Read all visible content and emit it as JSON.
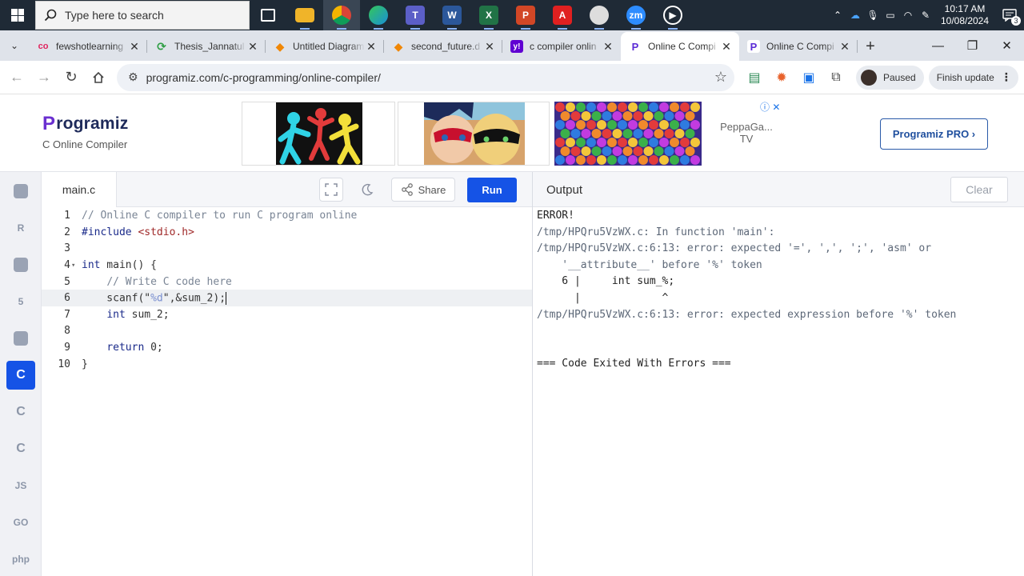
{
  "taskbar": {
    "search_placeholder": "Type here to search",
    "apps": [
      {
        "name": "task-view",
        "label": "",
        "color": "#1f2a36"
      },
      {
        "name": "file-explorer",
        "label": "",
        "color": "#f0b429"
      },
      {
        "name": "chrome",
        "label": "",
        "color": "#db4437"
      },
      {
        "name": "edge",
        "label": "",
        "color": "#2aa1d8"
      },
      {
        "name": "teams",
        "label": "T",
        "color": "#5b5fc7"
      },
      {
        "name": "word",
        "label": "W",
        "color": "#2b579a"
      },
      {
        "name": "excel",
        "label": "X",
        "color": "#217346"
      },
      {
        "name": "powerpoint",
        "label": "P",
        "color": "#d24726"
      },
      {
        "name": "acrobat",
        "label": "A",
        "color": "#e02020"
      },
      {
        "name": "paint",
        "label": "",
        "color": "#dddddd"
      },
      {
        "name": "zoom",
        "label": "zm",
        "color": "#2d8cff"
      },
      {
        "name": "media-player",
        "label": "▶",
        "color": "#333333"
      }
    ],
    "clock_time": "10:17 AM",
    "clock_date": "10/08/2024",
    "notification_count": "3"
  },
  "browser": {
    "tabs": [
      {
        "title": "fewshotlearning",
        "favicon_color": "#e0245e",
        "favicon_label": "co",
        "active": false
      },
      {
        "title": "Thesis_Jannatul",
        "favicon_color": "#2e9e44",
        "favicon_label": "⟳",
        "active": false
      },
      {
        "title": "Untitled Diagram",
        "favicon_color": "#f08705",
        "favicon_label": "◆",
        "active": false
      },
      {
        "title": "second_future.d",
        "favicon_color": "#f08705",
        "favicon_label": "◆",
        "active": false
      },
      {
        "title": "c compiler onlin",
        "favicon_color": "#6001d2",
        "favicon_label": "y!",
        "active": false
      },
      {
        "title": "Online C Compi",
        "favicon_color": "#ffffff",
        "favicon_label": "P",
        "active": true
      },
      {
        "title": "Online C Compi",
        "favicon_color": "#ffffff",
        "favicon_label": "P",
        "active": false
      }
    ],
    "url": "programiz.com/c-programming/online-compiler/",
    "profile_status": "Paused",
    "update_label": "Finish update"
  },
  "site": {
    "brand": "rogramiz",
    "brand_mark": "P",
    "subtitle": "C Online Compiler",
    "ad_label": "PeppaGa... TV",
    "pro_button": "Programiz PRO ›",
    "rail": [
      {
        "name": "python",
        "label": "",
        "active": false
      },
      {
        "name": "r",
        "label": "R",
        "active": false
      },
      {
        "name": "sql",
        "label": "",
        "active": false
      },
      {
        "name": "html",
        "label": "5",
        "active": false
      },
      {
        "name": "java",
        "label": "",
        "active": false
      },
      {
        "name": "c",
        "label": "C",
        "active": true
      },
      {
        "name": "cpp",
        "label": "C",
        "active": false
      },
      {
        "name": "csharp",
        "label": "C",
        "active": false
      },
      {
        "name": "js",
        "label": "JS",
        "active": false
      },
      {
        "name": "go",
        "label": "GO",
        "active": false
      },
      {
        "name": "php",
        "label": "php",
        "active": false
      }
    ]
  },
  "editor": {
    "filename": "main.c",
    "share_label": "Share",
    "run_label": "Run",
    "lines": [
      {
        "n": "1",
        "fold": "",
        "html": "<span class='c-com'>// Online C compiler to run C program online</span>"
      },
      {
        "n": "2",
        "fold": "",
        "html": "<span class='c-kw'>#include</span> <span class='c-inc'>&lt;stdio.h&gt;</span>"
      },
      {
        "n": "3",
        "fold": "",
        "html": ""
      },
      {
        "n": "4",
        "fold": "▾",
        "html": "<span class='c-kw'>int</span> main() {"
      },
      {
        "n": "5",
        "fold": "",
        "html": "    <span class='c-com'>// Write C code here</span>"
      },
      {
        "n": "6",
        "fold": "",
        "html": "    scanf(\"<span class='c-str'>%d</span>\",&amp;sum_2);<span class='caret'></span>",
        "current": true
      },
      {
        "n": "7",
        "fold": "",
        "html": "    <span class='c-kw'>int</span> sum_2;"
      },
      {
        "n": "8",
        "fold": "",
        "html": ""
      },
      {
        "n": "9",
        "fold": "",
        "html": "    <span class='c-kw'>return</span> 0;"
      },
      {
        "n": "10",
        "fold": "",
        "html": "}"
      }
    ]
  },
  "output": {
    "title": "Output",
    "clear_label": "Clear",
    "lines": [
      {
        "text": "ERROR!",
        "dark": true
      },
      {
        "text": "/tmp/HPQru5VzWX.c: In function 'main':",
        "dark": false
      },
      {
        "text": "/tmp/HPQru5VzWX.c:6:13: error: expected '=', ',', ';', 'asm' or",
        "dark": false
      },
      {
        "text": "    '__attribute__' before '%' token",
        "dark": false
      },
      {
        "text": "    6 |     int sum_%;",
        "dark": true
      },
      {
        "text": "      |             ^",
        "dark": true
      },
      {
        "text": "/tmp/HPQru5VzWX.c:6:13: error: expected expression before '%' token",
        "dark": false
      },
      {
        "text": "",
        "dark": false
      },
      {
        "text": "",
        "dark": false
      },
      {
        "text": "=== Code Exited With Errors ===",
        "dark": true
      }
    ]
  }
}
